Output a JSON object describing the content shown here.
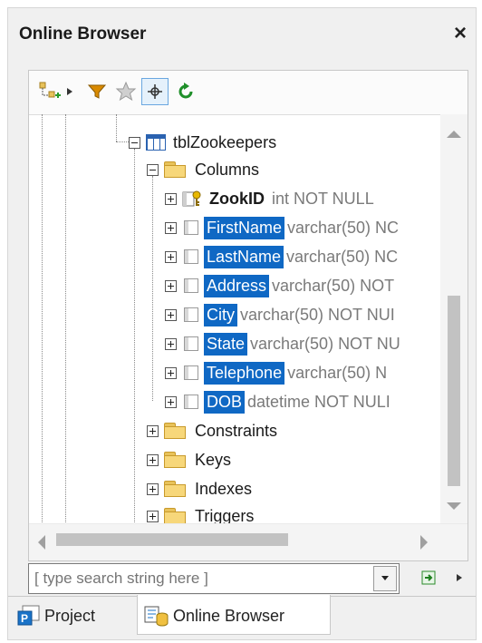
{
  "window": {
    "title": "Online Browser",
    "close_glyph": "×"
  },
  "toolbar": {
    "items": [
      {
        "name": "add-layout-icon"
      },
      {
        "name": "filter-icon"
      },
      {
        "name": "favorites-star-icon"
      },
      {
        "name": "crosshair-icon"
      },
      {
        "name": "refresh-icon"
      }
    ]
  },
  "tree": {
    "table": "tblZookeepers",
    "columns_folder": "Columns",
    "columns": [
      {
        "name": "ZookID",
        "type": "int NOT NULL",
        "selected": false
      },
      {
        "name": "FirstName",
        "type": "varchar(50) NC",
        "selected": true
      },
      {
        "name": "LastName",
        "type": "varchar(50) NC",
        "selected": true
      },
      {
        "name": "Address",
        "type": "varchar(50) NOT",
        "selected": true
      },
      {
        "name": "City",
        "type": "varchar(50) NOT NUI",
        "selected": true
      },
      {
        "name": "State",
        "type": "varchar(50) NOT NU",
        "selected": true
      },
      {
        "name": "Telephone",
        "type": "varchar(50) N",
        "selected": true
      },
      {
        "name": "DOB",
        "type": "datetime NOT NULI",
        "selected": true
      }
    ],
    "folders": [
      "Constraints",
      "Keys",
      "Indexes",
      "Triggers"
    ]
  },
  "search": {
    "placeholder": "[ type search string here ]"
  },
  "tabs": [
    {
      "label": "Project",
      "active": false
    },
    {
      "label": "Online Browser",
      "active": true
    }
  ],
  "colors": {
    "selection": "#0f68c4",
    "accent_green": "#1f8f2a",
    "folder": "#f7d77a"
  }
}
